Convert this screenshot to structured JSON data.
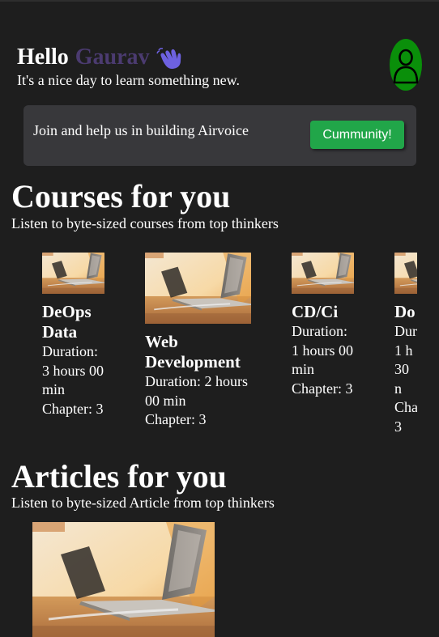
{
  "header": {
    "hello": "Hello",
    "name": "Gaurav",
    "subtitle": "It's a nice day to learn something new.",
    "wave_icon": "waving-hand-icon",
    "avatar_icon": "user-icon"
  },
  "community": {
    "text": "Join and help us in building Airvoice",
    "button_label": "Cummunity!"
  },
  "courses": {
    "title": "Courses for you",
    "subtitle": "Listen to byte-sized courses from top thinkers",
    "items": [
      {
        "title": "DeOps Data",
        "duration": "Duration: 3 hours 00 min",
        "chapter": "Chapter: 3"
      },
      {
        "title": "Web Development",
        "duration": "Duration: 2 hours 00 min",
        "chapter": "Chapter: 3"
      },
      {
        "title": "CD/Ci",
        "duration": "Duration: 1 hours 00 min",
        "chapter": "Chapter: 3"
      },
      {
        "title": "Do",
        "duration": "Dur 1 h 30 n",
        "chapter": "Cha 3"
      }
    ]
  },
  "articles": {
    "title": "Articles for you",
    "subtitle": "Listen to byte-sized Article from top thinkers"
  },
  "colors": {
    "background": "#1e1e1e",
    "card": "#38383b",
    "accent_green": "#21a649",
    "avatar_green": "#0a8f0a",
    "name_purple": "#4b3b70"
  }
}
